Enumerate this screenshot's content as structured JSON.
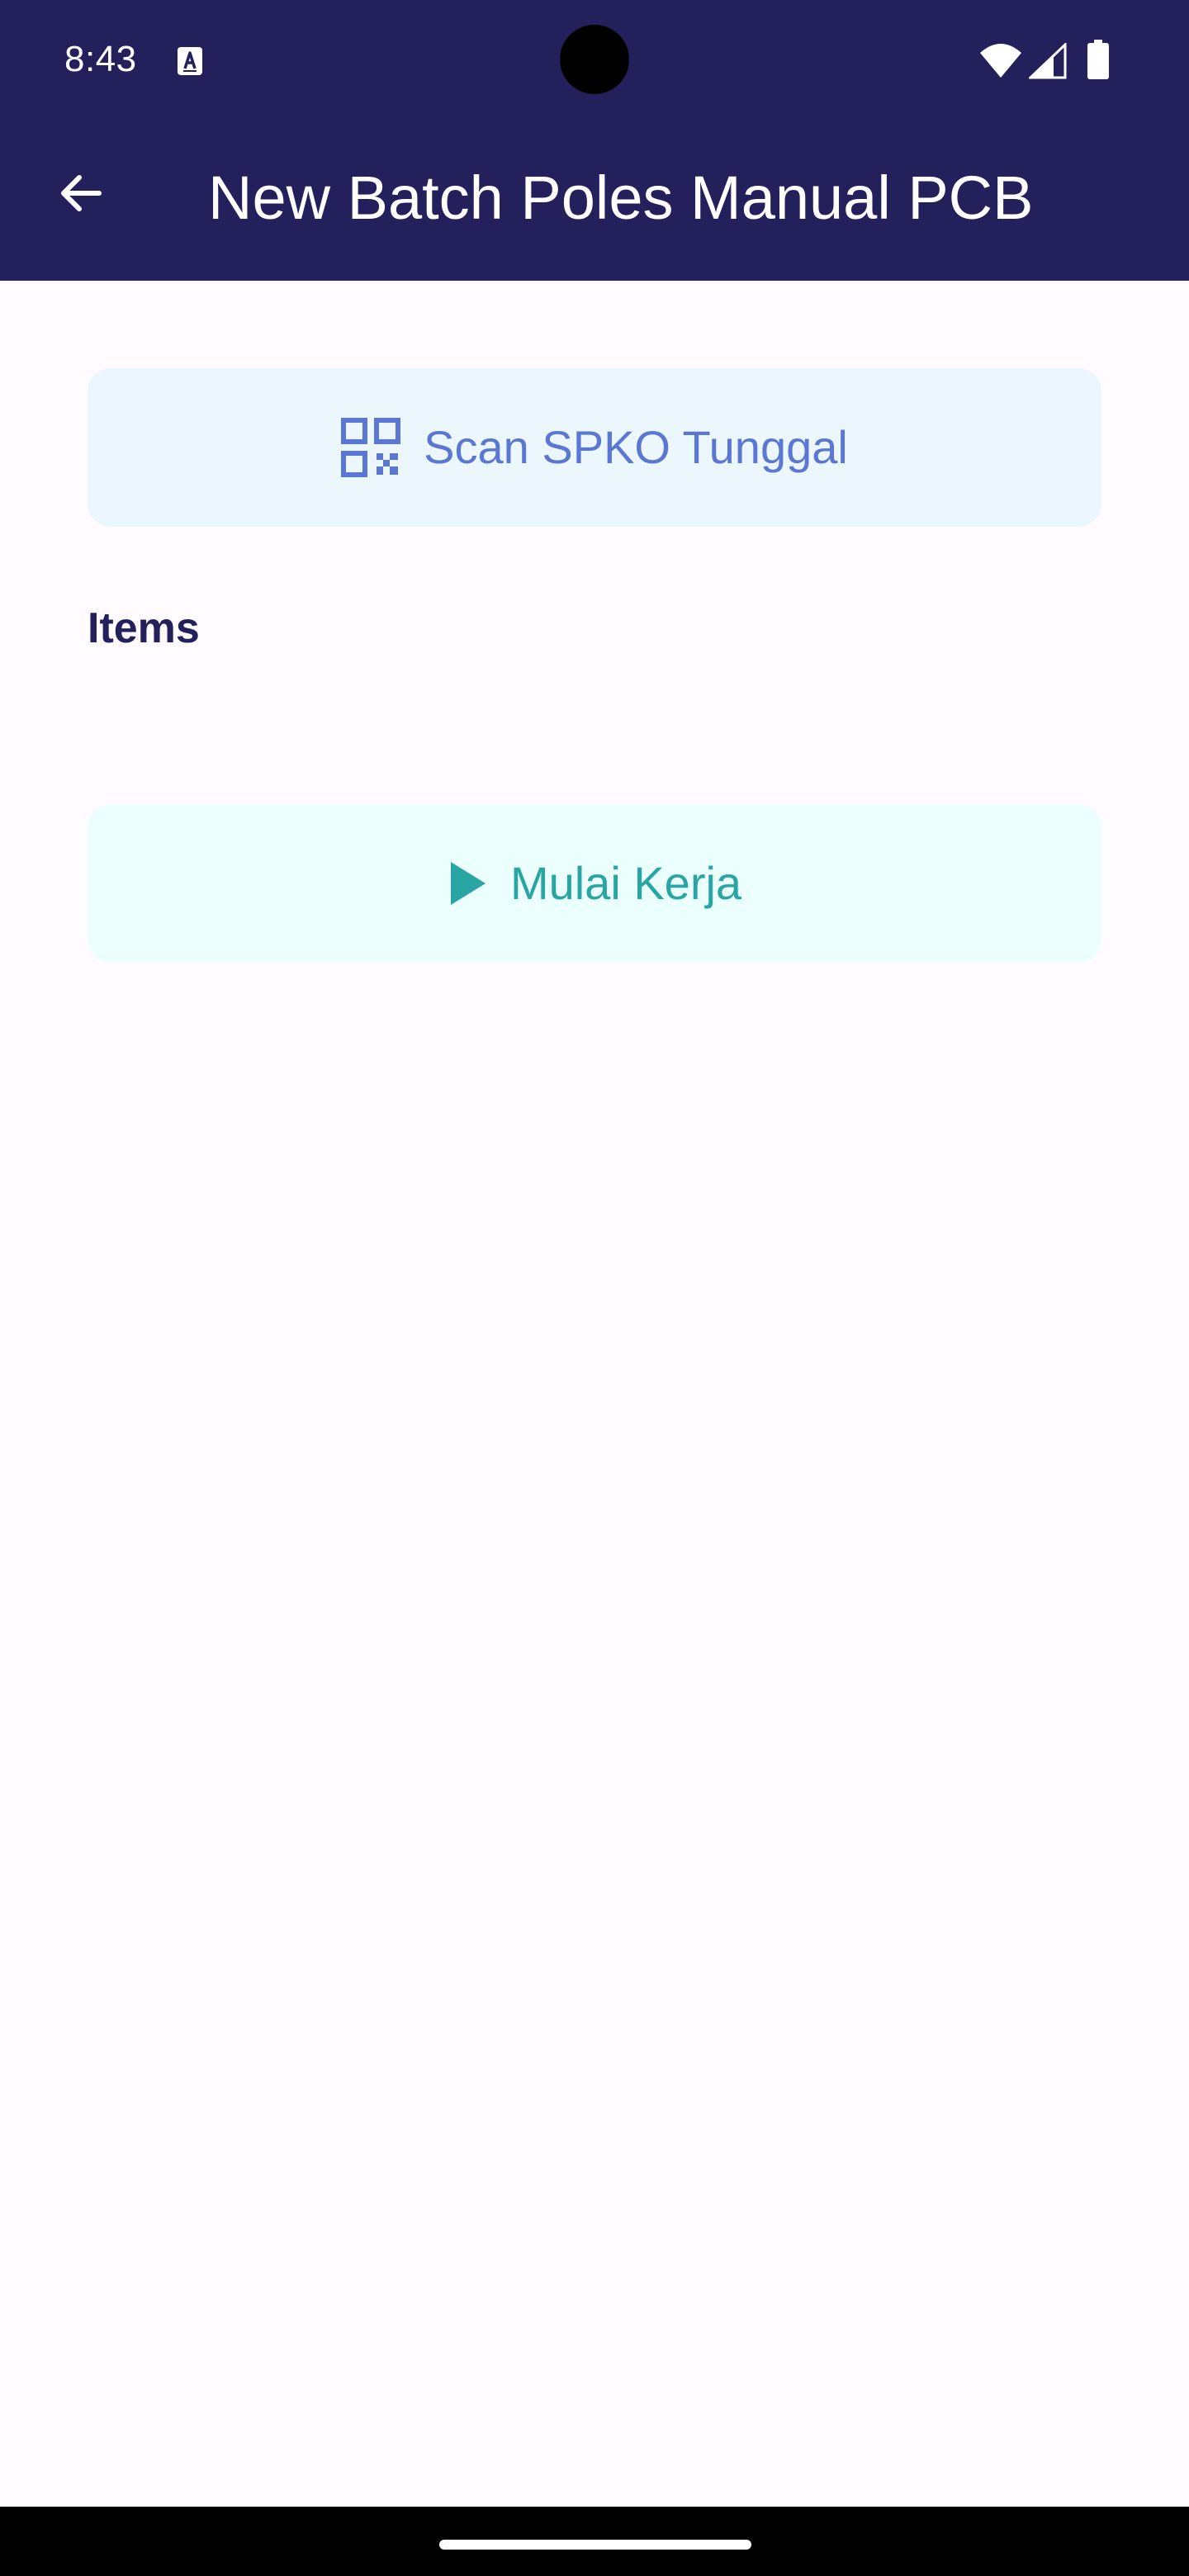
{
  "status_bar": {
    "time": "8:43",
    "notification_icon": "text-a-icon",
    "icons": [
      "wifi-icon",
      "cell-signal-icon",
      "battery-icon"
    ]
  },
  "toolbar": {
    "back_icon": "arrow-left-icon",
    "title": "New Batch Poles Manual PCB"
  },
  "actions": {
    "scan": {
      "icon": "qr-code-icon",
      "label": "Scan SPKO Tunggal"
    },
    "start": {
      "icon": "play-icon",
      "label": "Mulai Kerja"
    }
  },
  "items_section": {
    "heading": "Items",
    "items": []
  },
  "colors": {
    "app_bar": "#23205c",
    "background": "#fffbff",
    "scan_button_bg": "#ebf6fd",
    "scan_button_fg": "#5b77d4",
    "start_button_bg": "#ebfffc",
    "start_button_fg": "#29a6a4",
    "heading": "#23205c"
  }
}
